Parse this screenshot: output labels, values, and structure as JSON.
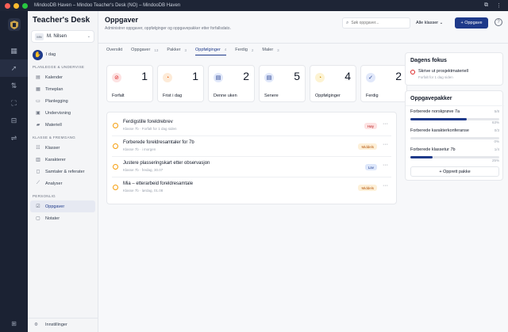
{
  "window": {
    "title": "MindooDB Haven – Mindoo Teacher's Desk (NO) – MindooDB Haven"
  },
  "rail": {
    "items": [
      "dashboard-icon",
      "rocket-icon",
      "swap-icon",
      "scan-icon",
      "database-icon",
      "sliders-icon"
    ]
  },
  "sidebar": {
    "brand": "Teacher's Desk",
    "user": {
      "initials": "MN",
      "name": "M. Nilsen"
    },
    "today_label": "I dag",
    "sections": [
      {
        "title": "PLANLEGGE & UNDERVISE",
        "items": [
          "Kalender",
          "Timeplan",
          "Planlegging",
          "Undervisning",
          "Materiell"
        ]
      },
      {
        "title": "KLASSE & FREMGANG",
        "items": [
          "Klasser",
          "Karakterer",
          "Samtaler & referater",
          "Analyser"
        ]
      },
      {
        "title": "PERSONLIG",
        "items": [
          "Oppgaver",
          "Notater"
        ]
      }
    ],
    "settings_label": "Innstillinger"
  },
  "header": {
    "title": "Oppgaver",
    "subtitle": "Administrer oppgaver, oppfølginger og oppgavepakker etter forfallsdato.",
    "search_placeholder": "Søk oppgaver...",
    "class_filter": "Alle klasser",
    "new_button": "+ Oppgave"
  },
  "tabs": [
    {
      "label": "Oversikt",
      "count": ""
    },
    {
      "label": "Oppgaver",
      "count": "13"
    },
    {
      "label": "Pakker",
      "count": "3"
    },
    {
      "label": "Oppfølginger",
      "count": "4"
    },
    {
      "label": "Ferdig",
      "count": "2"
    },
    {
      "label": "Maler",
      "count": "3"
    }
  ],
  "stats": [
    {
      "label": "Forfalt",
      "value": "1",
      "icon": "alert-icon",
      "color": "#dc2626",
      "bg": "#fde2e2"
    },
    {
      "label": "Frist i dag",
      "value": "1",
      "icon": "clock-icon",
      "color": "#ea580c",
      "bg": "#fdebd8"
    },
    {
      "label": "Denne uken",
      "value": "2",
      "icon": "calendar-icon",
      "color": "#1e3a8a",
      "bg": "#e1e8fa"
    },
    {
      "label": "Senere",
      "value": "5",
      "icon": "calendar-icon",
      "color": "#1e3a8a",
      "bg": "#e1e8fa"
    },
    {
      "label": "Oppfølginger",
      "value": "4",
      "icon": "clock-icon",
      "color": "#ca8a04",
      "bg": "#fdf3d2"
    },
    {
      "label": "Ferdig",
      "value": "2",
      "icon": "check-icon",
      "color": "#1e3a8a",
      "bg": "#e1e8fa"
    }
  ],
  "tasks": [
    {
      "title": "Ferdigstille foreldrebrev",
      "meta": "Klasse 7b · Forfalt for 1 dag siden",
      "badge": "Høy",
      "badge_class": "b-hoy"
    },
    {
      "title": "Forberede foreldresamtaler for 7b",
      "meta": "Klasse 7b · i morgen",
      "badge": "Middels",
      "badge_class": "b-mid"
    },
    {
      "title": "Justere plasseringskart etter observasjon",
      "meta": "Klasse 7b · fredag, 30.07",
      "badge": "Lav",
      "badge_class": "b-lav"
    },
    {
      "title": "Mia – etterarbeid foreldresamtale",
      "meta": "Klasse 7b · lørdag, 01.08",
      "badge": "Middels",
      "badge_class": "b-mid"
    }
  ],
  "focus": {
    "title": "Dagens fokus",
    "item": "Skrive ut prosjektmateriell",
    "meta": "Forfalt for 1 dag siden"
  },
  "packs": {
    "title": "Oppgavepakker",
    "items": [
      {
        "name": "Forberede norskprøve 7a",
        "fraction": "5/8",
        "percent": "63%",
        "progress": 0.63
      },
      {
        "name": "Forberede karakterkonferanse",
        "fraction": "0/3",
        "percent": "0%",
        "progress": 0
      },
      {
        "name": "Forberede klassetur 7b",
        "fraction": "1/4",
        "percent": "25%",
        "progress": 0.25
      }
    ],
    "create_label": "+ Opprett pakke"
  }
}
